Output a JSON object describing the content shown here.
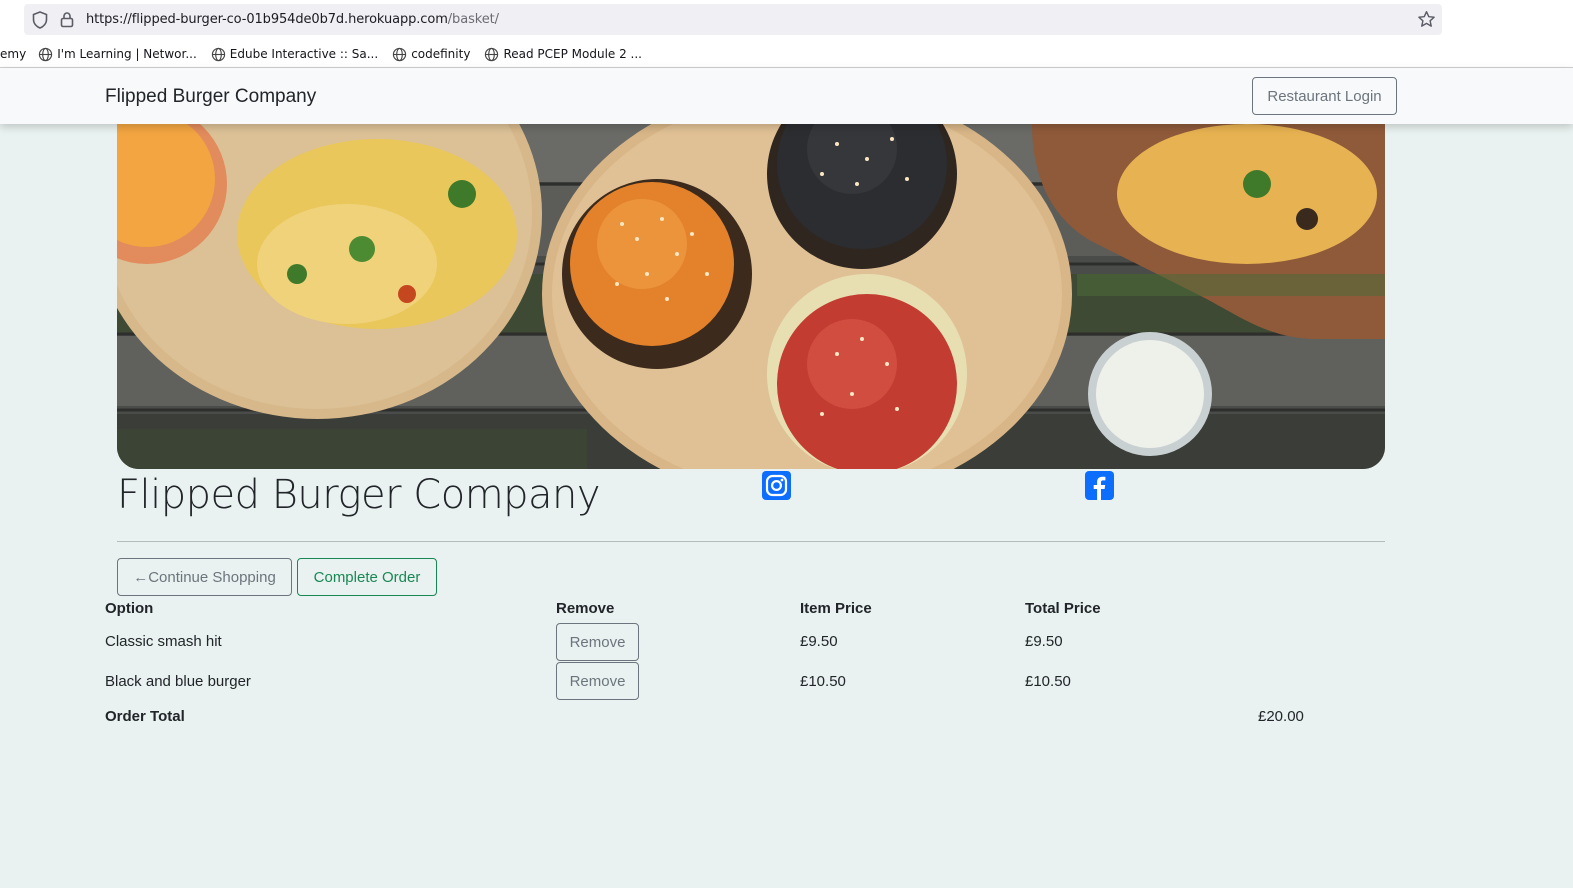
{
  "browser": {
    "url_host": "https://flipped-burger-co-01b954de0b7d.herokuapp.com",
    "url_path": "/basket/",
    "bookmarks": [
      "emy",
      "I'm Learning | Networ...",
      "Edube Interactive :: Sa...",
      "codefinity",
      "Read PCEP Module 2 ..."
    ]
  },
  "navbar": {
    "brand": "Flipped Burger Company",
    "login_label": "Restaurant Login"
  },
  "header": {
    "title": "Flipped Burger Company",
    "social_icons": [
      "instagram-icon",
      "facebook-icon"
    ]
  },
  "actions": {
    "continue_label": "←Continue Shopping",
    "complete_label": "Complete Order"
  },
  "table": {
    "headers": [
      "Option",
      "Remove",
      "Item Price",
      "Total Price"
    ],
    "rows": [
      {
        "option": "Classic smash hit",
        "remove_label": "Remove",
        "item_price": "£9.50",
        "total_price": "£9.50"
      },
      {
        "option": "Black and blue burger",
        "remove_label": "Remove",
        "item_price": "£10.50",
        "total_price": "£10.50"
      }
    ],
    "order_total_label": "Order Total",
    "order_total_value": "£20.00"
  },
  "colors": {
    "page_bg": "#e9f2f0",
    "secondary": "#6c757d",
    "success": "#198754",
    "social_blue": "#0d6efd"
  }
}
